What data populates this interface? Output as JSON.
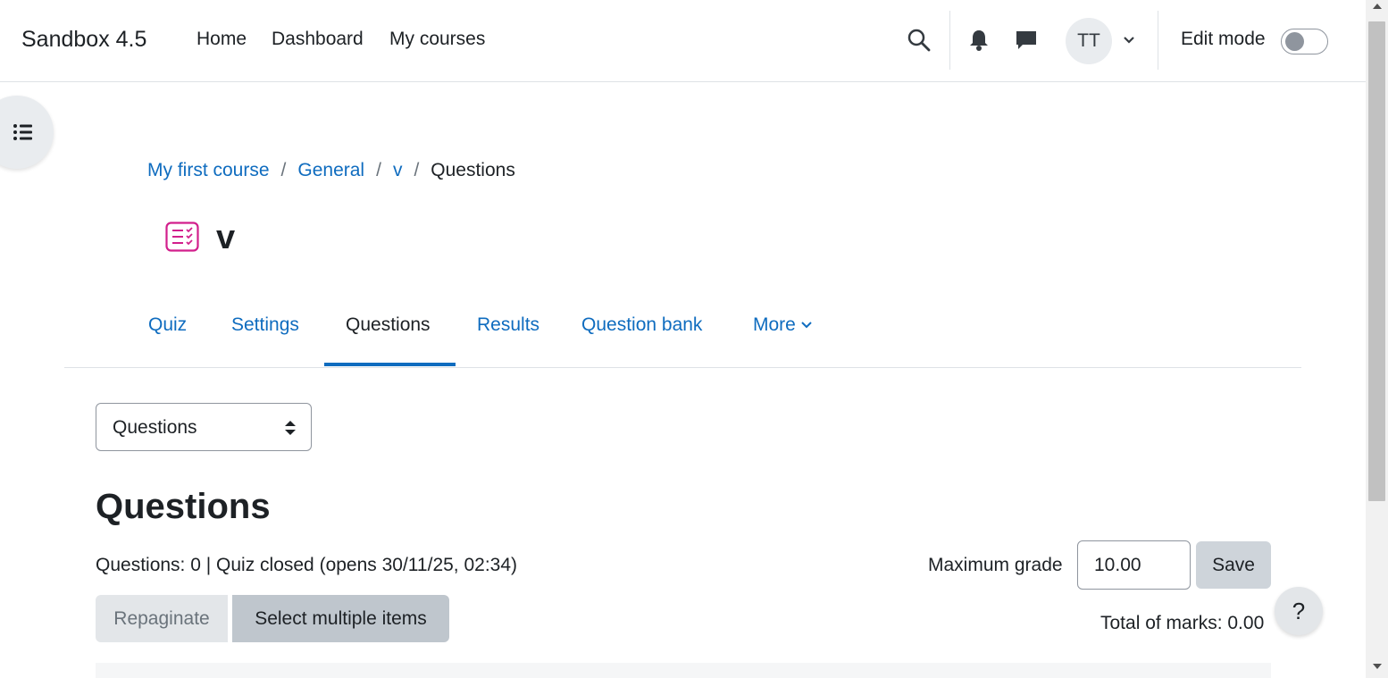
{
  "navbar": {
    "brand": "Sandbox 4.5",
    "links": [
      "Home",
      "Dashboard",
      "My courses"
    ],
    "user_initials": "TT",
    "edit_mode_label": "Edit mode",
    "edit_mode_on": false
  },
  "breadcrumb": {
    "items": [
      "My first course",
      "General",
      "v"
    ],
    "current": "Questions",
    "separator": "/"
  },
  "page": {
    "title": "v",
    "icon": "quiz-icon",
    "accent_color": "#d21f8c"
  },
  "tabs": {
    "items": [
      "Quiz",
      "Settings",
      "Questions",
      "Results",
      "Question bank",
      "More"
    ],
    "active": "Questions"
  },
  "select": {
    "value": "Questions"
  },
  "content": {
    "heading": "Questions",
    "status": "Questions: 0 | Quiz closed (opens 30/11/25, 02:34)",
    "max_grade_label": "Maximum grade",
    "max_grade_value": "10.00",
    "save_label": "Save",
    "repaginate_label": "Repaginate",
    "select_multiple_label": "Select multiple items",
    "total_marks": "Total of marks: 0.00",
    "help_label": "?"
  },
  "colors": {
    "link": "#0f6cbf",
    "text": "#1d2125"
  }
}
